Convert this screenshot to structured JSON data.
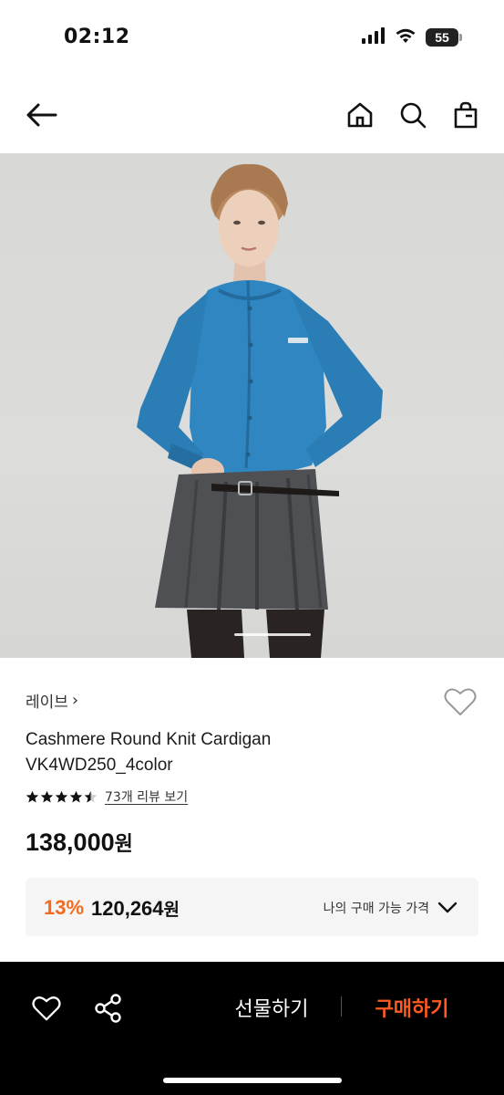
{
  "status_bar": {
    "time": "02:12",
    "battery": "55",
    "icons": [
      "signal-icon",
      "wifi-icon",
      "battery-icon"
    ]
  },
  "nav": {
    "icons": [
      "back-arrow-icon",
      "home-icon",
      "search-icon",
      "shopping-bag-icon"
    ]
  },
  "hero": {
    "image": "product-photo",
    "indicator": "image-slider-indicator"
  },
  "product": {
    "brand": "레이브",
    "brand_chevron": "›",
    "title_line1": "Cashmere Round Knit Cardigan",
    "title_line2": "VK4WD250_4color",
    "rating": 4.5,
    "reviews_text": "73개 리뷰 보기",
    "price_number": "138,000",
    "price_unit": "원"
  },
  "discount": {
    "percent": "13%",
    "price_number": "120,264",
    "price_unit": "원",
    "label": "나의 구매 가능 가격"
  },
  "bottom_bar": {
    "gift_label": "선물하기",
    "buy_label": "구매하기"
  },
  "colors": {
    "accent_orange": "#f26b1d",
    "buy_orange": "#ff5a1f",
    "bottom_bar_bg": "#000000",
    "discount_box_bg": "#f5f5f6",
    "cardigan_blue": "#2f86c0",
    "skirt_gray": "#4e5054"
  }
}
